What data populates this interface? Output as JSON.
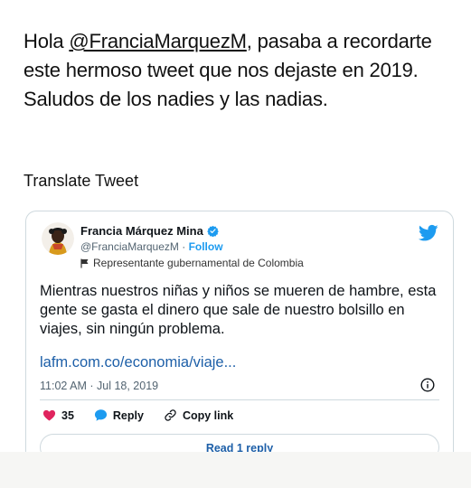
{
  "tweet": {
    "text_before": "Hola ",
    "mention": "@FranciaMarquezM",
    "text_after": ", pasaba a recordarte este hermoso tweet que nos dejaste en 2019. Saludos de los nadies y las nadias."
  },
  "translate_label": "Translate Tweet",
  "embed": {
    "author_name": "Francia Márquez Mina",
    "handle": "@FranciaMarquezM",
    "separator": " · ",
    "follow_label": "Follow",
    "account_label": "Representante gubernamental de Colombia",
    "body": "Mientras nuestros niñas y niños se mueren de hambre, esta gente se gasta el dinero que sale de nuestro bolsillo en viajes, sin ningún problema.",
    "link": "lafm.com.co/economia/viaje...",
    "timestamp": "11:02 AM · Jul 18, 2019",
    "likes": "35",
    "reply_label": "Reply",
    "copy_link_label": "Copy link",
    "read_reply_label": "Read 1 reply"
  },
  "colors": {
    "accent": "#1d9bf0",
    "like": "#e0245e",
    "link": "#1d5fa8"
  },
  "icons": [
    "verified-icon",
    "twitter-bird-icon",
    "flag-icon",
    "info-icon",
    "heart-icon",
    "reply-bubble-icon",
    "copy-link-icon"
  ]
}
